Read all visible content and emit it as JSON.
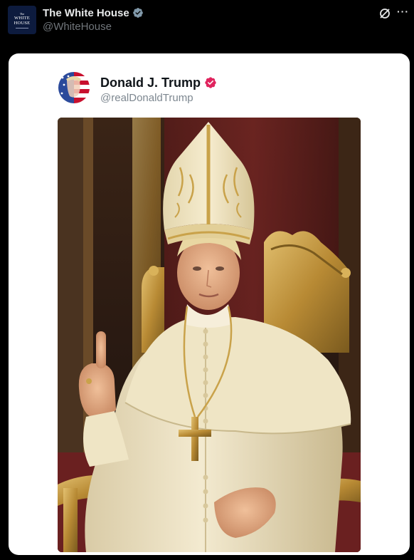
{
  "tweet": {
    "author": {
      "display_name": "The White House",
      "handle": "@WhiteHouse",
      "avatar_lines": [
        "The",
        "WHITE",
        "HOUSE"
      ]
    },
    "actions": {
      "grok_icon": "grok-icon",
      "more_icon": "more-icon"
    }
  },
  "embedded_post": {
    "author": {
      "display_name": "Donald J. Trump",
      "handle": "@realDonaldTrump",
      "verified_color": "#e0245e"
    },
    "media": {
      "type": "image"
    }
  },
  "colors": {
    "background": "#000000",
    "card": "#ffffff",
    "primary_text": "#e7e9ea",
    "secondary_text": "#71767b"
  }
}
